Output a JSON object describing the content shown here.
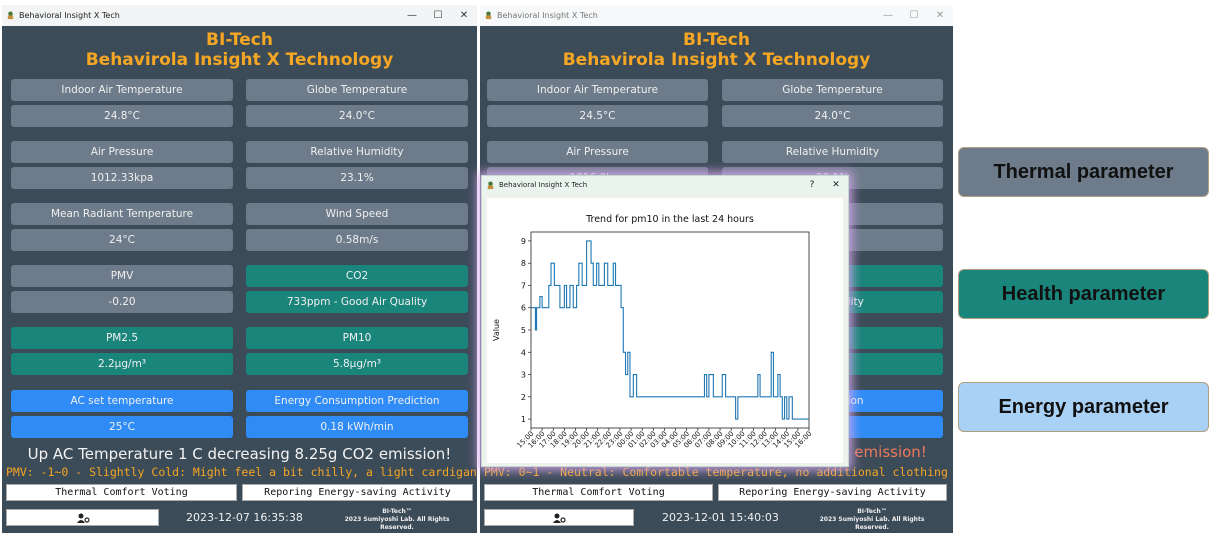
{
  "left_window": {
    "title": "Behavioral Insight X Tech",
    "brand_line1": "BI-Tech",
    "brand_line2": "Behavirola Insight X Technology",
    "cells": [
      {
        "label": "Indoor Air Temperature",
        "value": "24.8°C",
        "color": "gray"
      },
      {
        "label": "Globe Temperature",
        "value": "24.0°C",
        "color": "gray"
      },
      {
        "label": "Air Pressure",
        "value": "1012.33kpa",
        "color": "gray"
      },
      {
        "label": "Relative Humidity",
        "value": "23.1%",
        "color": "gray"
      },
      {
        "label": "Mean Radiant Temperature",
        "value": "24°C",
        "color": "gray"
      },
      {
        "label": "Wind Speed",
        "value": "0.58m/s",
        "color": "gray"
      },
      {
        "label": "PMV",
        "value": "-0.20",
        "color": "gray"
      },
      {
        "label": "CO2",
        "value": "733ppm - Good Air Quality",
        "color": "teal"
      },
      {
        "label": "PM2.5",
        "value": "2.2μg/m³",
        "color": "teal"
      },
      {
        "label": "PM10",
        "value": "5.8μg/m³",
        "color": "teal"
      },
      {
        "label": "AC set temperature",
        "value": "25°C",
        "color": "blue"
      },
      {
        "label": "Energy Consumption Prediction",
        "value": "0.18 kWh/min",
        "color": "blue"
      }
    ],
    "suggestion": "Up AC Temperature 1 C decreasing 8.25g CO2 emission!",
    "pmv_message": "PMV: -1~0 - Slightly Cold: Might feel a bit chilly, a light cardigan could help.",
    "vote_button": "Thermal Comfort Voting",
    "report_button": "Reporing Energy-saving Activity",
    "timestamp": "2023-12-07 16:35:38",
    "copyright_line1": "BI-Tech™",
    "copyright_line2": "2023 Sumiyoshi Lab. All Rights Reserved."
  },
  "right_window": {
    "title": "Behavioral Insight X Tech",
    "brand_line1": "BI-Tech",
    "brand_line2": "Behavirola Insight X Technology",
    "cells": [
      {
        "label": "Indoor Air Temperature",
        "value": "24.5°C",
        "color": "gray"
      },
      {
        "label": "Globe Temperature",
        "value": "24.0°C",
        "color": "gray"
      },
      {
        "label": "Air Pressure",
        "value": "1016.0kpa",
        "color": "gray"
      },
      {
        "label": "Relative Humidity",
        "value": "20.1%",
        "color": "gray"
      },
      {
        "label": "",
        "value": "",
        "color": "gray"
      },
      {
        "label": "eed",
        "value": "s",
        "color": "gray"
      },
      {
        "label": "",
        "value": "",
        "color": "gray"
      },
      {
        "label": "",
        "value": "t Air Quality",
        "color": "teal"
      },
      {
        "label": "",
        "value": "",
        "color": "teal"
      },
      {
        "label": "",
        "value": "m³",
        "color": "teal"
      },
      {
        "label": "",
        "value": "",
        "color": "blue"
      },
      {
        "label": "n Prediction",
        "value": "/min",
        "color": "blue"
      }
    ],
    "suggestion_tail": "2 emission!",
    "pmv_message": "PMV: 0~1 - Neutral: Comfortable temperature, no additional clothing needed.",
    "vote_button": "Thermal Comfort Voting",
    "report_button": "Reporing Energy-saving Activity",
    "timestamp": "2023-12-01 15:40:03",
    "copyright_line1": "BI-Tech™",
    "copyright_line2": "2023 Sumiyoshi Lab. All Rights Reserved."
  },
  "popup": {
    "title": "Behavioral Insight X Tech",
    "help": "?",
    "close": "✕"
  },
  "chart_data": {
    "type": "line",
    "title": "Trend for pm10 in the last 24 hours",
    "xlabel": "",
    "ylabel": "Value",
    "ylim": [
      0.6,
      9.4
    ],
    "yticks": [
      1,
      2,
      3,
      4,
      5,
      6,
      7,
      8,
      9
    ],
    "xticks": [
      "15:00",
      "16:00",
      "17:00",
      "18:00",
      "19:00",
      "20:00",
      "21:00",
      "22:00",
      "23:00",
      "00:00",
      "01:00",
      "02:00",
      "03:00",
      "04:00",
      "05:00",
      "06:00",
      "07:00",
      "08:00",
      "09:00",
      "10:00",
      "11:00",
      "12:00",
      "13:00",
      "14:00",
      "15:00",
      "16:00"
    ],
    "x_hours": [
      0.0,
      0.4,
      0.5,
      0.8,
      1.0,
      1.6,
      1.8,
      2.1,
      2.6,
      2.8,
      3.0,
      3.2,
      3.5,
      3.8,
      4.1,
      4.3,
      4.6,
      5.0,
      5.4,
      5.6,
      5.9,
      6.1,
      6.3,
      6.6,
      6.9,
      7.1,
      7.4,
      7.6,
      7.9,
      8.1,
      8.3,
      8.5,
      8.7,
      8.9,
      9.2,
      9.5,
      10,
      11,
      12,
      13,
      13.8,
      14.0,
      14.2,
      14.4,
      15.0,
      15.6,
      15.8,
      16.0,
      16.4,
      16.6,
      17.0,
      17.2,
      17.5,
      18.0,
      18.4,
      18.6,
      19.0,
      19.2,
      19.6,
      20.0,
      20.4,
      20.6,
      21.0,
      21.4,
      21.6,
      21.8,
      22.0,
      22.2,
      22.4,
      22.6,
      22.8,
      23.0,
      23.2,
      23.5,
      24.0,
      24.5,
      25.0
    ],
    "values": [
      6,
      5,
      6,
      6.5,
      6,
      7,
      8,
      7,
      6,
      6,
      7,
      6,
      7,
      6,
      7,
      8,
      7,
      9,
      8,
      7,
      8,
      7,
      7,
      8,
      7,
      7,
      8,
      7,
      7,
      6,
      4,
      3,
      4,
      2,
      3,
      2,
      2,
      2,
      2,
      2,
      2,
      2,
      2,
      2,
      2,
      3,
      2,
      3,
      2,
      2,
      2,
      3,
      2,
      2,
      1,
      2,
      2,
      2,
      2,
      2,
      3,
      2,
      2,
      2,
      4,
      2,
      2,
      3,
      2,
      1,
      2,
      1,
      2,
      1,
      1,
      1,
      1
    ]
  },
  "badges": {
    "thermal": "Thermal parameter",
    "health": "Health parameter",
    "energy": "Energy parameter"
  },
  "colors": {
    "window_bg": "#3c4b58",
    "gray_cell": "#6d7b8a",
    "teal_cell": "#1a857b",
    "blue_cell": "#2f8cf7",
    "brand": "#f5a623",
    "badge_thermal": "#6d7b8a",
    "badge_health": "#1a857b",
    "badge_energy": "#a9d0f5",
    "line": "#1f77b4"
  }
}
